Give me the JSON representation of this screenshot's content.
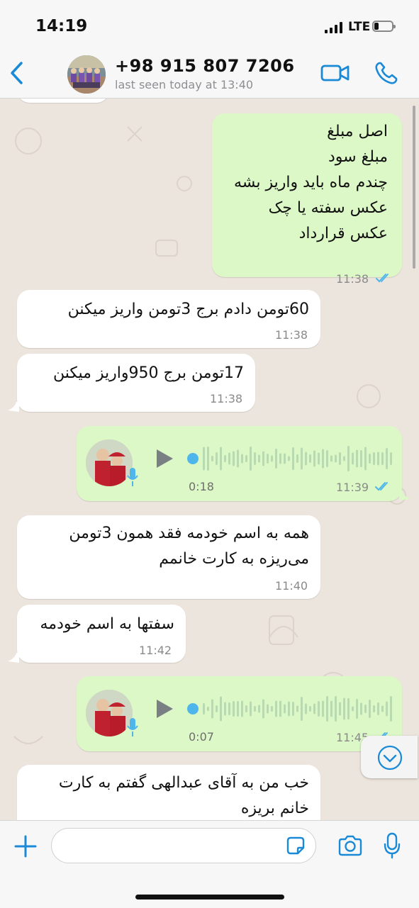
{
  "status_bar": {
    "time": "14:19",
    "network": "LTE"
  },
  "header": {
    "contact_name": "+98 915 807 7206",
    "last_seen": "last seen today at 13:40",
    "back_icon": "chevron-left-icon",
    "video_icon": "video-camera-icon",
    "call_icon": "phone-icon"
  },
  "messages": [
    {
      "direction": "out",
      "type": "text",
      "text": "اصل مبلغ\nمبلغ سود\nچندم ماه باید واریز بشه\nعکس سفته یا چک\nعکس قرارداد",
      "time": "11:38",
      "status": "read"
    },
    {
      "direction": "in",
      "type": "text",
      "text": "60تومن دادم برج 3تومن واریز میکنن",
      "time": "11:38"
    },
    {
      "direction": "in",
      "type": "text",
      "text": "17تومن برج 950واریز میکنن",
      "time": "11:38"
    },
    {
      "direction": "out",
      "type": "voice",
      "duration": "0:18",
      "time": "11:39",
      "status": "read"
    },
    {
      "direction": "in",
      "type": "text",
      "text": "همه به اسم خودمه فقد همون 3تومن\nمی‌ریزه به کارت خانمم",
      "time": "11:40"
    },
    {
      "direction": "in",
      "type": "text",
      "text": "سفتها به اسم خودمه",
      "time": "11:42"
    },
    {
      "direction": "out",
      "type": "voice",
      "duration": "0:07",
      "time": "11:45",
      "status": "read"
    },
    {
      "direction": "in",
      "type": "text",
      "text": "خب من به آقای عبدالهی گفتم به کارت\nخانم بریزه",
      "time": ""
    }
  ],
  "input_bar": {
    "placeholder": "",
    "plus_icon": "plus-icon",
    "sticker_icon": "sticker-icon",
    "camera_icon": "camera-icon",
    "mic_icon": "microphone-icon"
  },
  "colors": {
    "accent": "#1a8ad7",
    "outgoing_bubble": "#dcf8c6",
    "incoming_bubble": "#ffffff",
    "chat_background": "#ece5dd",
    "read_ticks": "#4fb6ec"
  }
}
